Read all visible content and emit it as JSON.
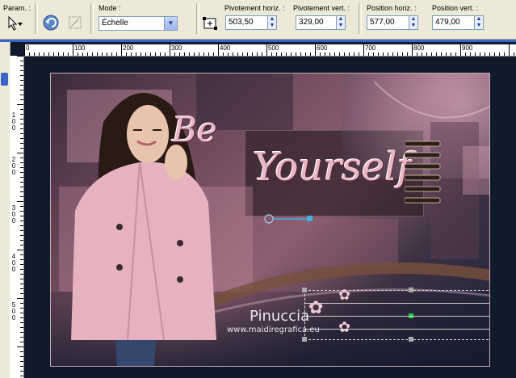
{
  "toolbar": {
    "param_label": "Param. :",
    "mode_label": "Mode :",
    "mode_value": "Échelle",
    "pivot_h_label": "Pivotement horiz. :",
    "pivot_h_value": "503,50",
    "pivot_v_label": "Pivotement vert. :",
    "pivot_v_value": "329,00",
    "pos_h_label": "Position horiz. :",
    "pos_h_value": "577,00",
    "pos_v_label": "Position vert. :",
    "pos_v_value": "479,00"
  },
  "ruler": {
    "h_ticks": [
      "0",
      "100",
      "200",
      "300",
      "400",
      "500",
      "600",
      "700",
      "800",
      "900"
    ],
    "v_ticks": [
      "100",
      "200",
      "300",
      "400",
      "500"
    ]
  },
  "artwork": {
    "title_be": "Be",
    "title_yourself": "Yourself",
    "signature": "Pinuccia",
    "website": "www.maidiregrafica.eu"
  },
  "colors": {
    "accent_pink": "#e9b7c6",
    "canvas_bg": "#0f1a2a",
    "handle_green": "#22cc44"
  }
}
